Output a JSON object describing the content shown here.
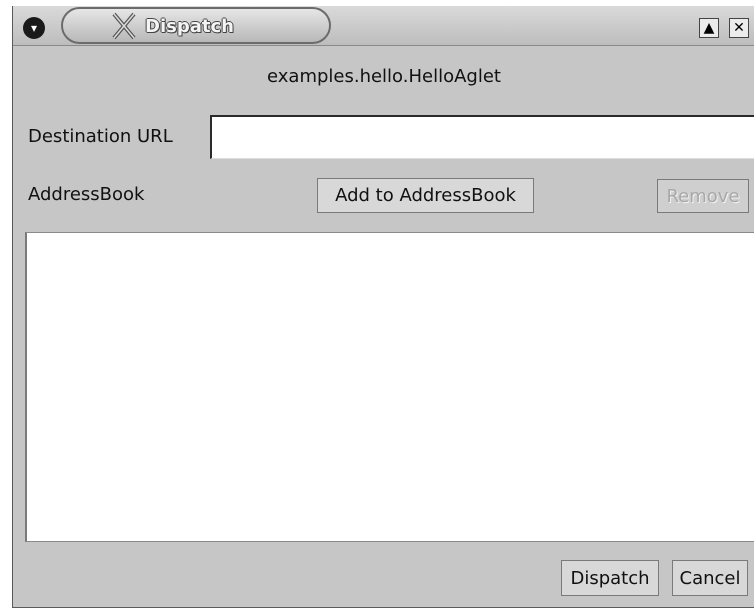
{
  "window": {
    "title": "Dispatch",
    "title_icon": "x-app-icon",
    "menu_icon": "window-menu-icon",
    "maximize_label": "▲",
    "close_label": "✕"
  },
  "aglet_name": "examples.hello.HelloAglet",
  "destination": {
    "label": "Destination URL",
    "value": ""
  },
  "address_book": {
    "label": "AddressBook",
    "add_label": "Add to AddressBook",
    "remove_label": "Remove",
    "items": []
  },
  "actions": {
    "dispatch_label": "Dispatch",
    "cancel_label": "Cancel"
  }
}
